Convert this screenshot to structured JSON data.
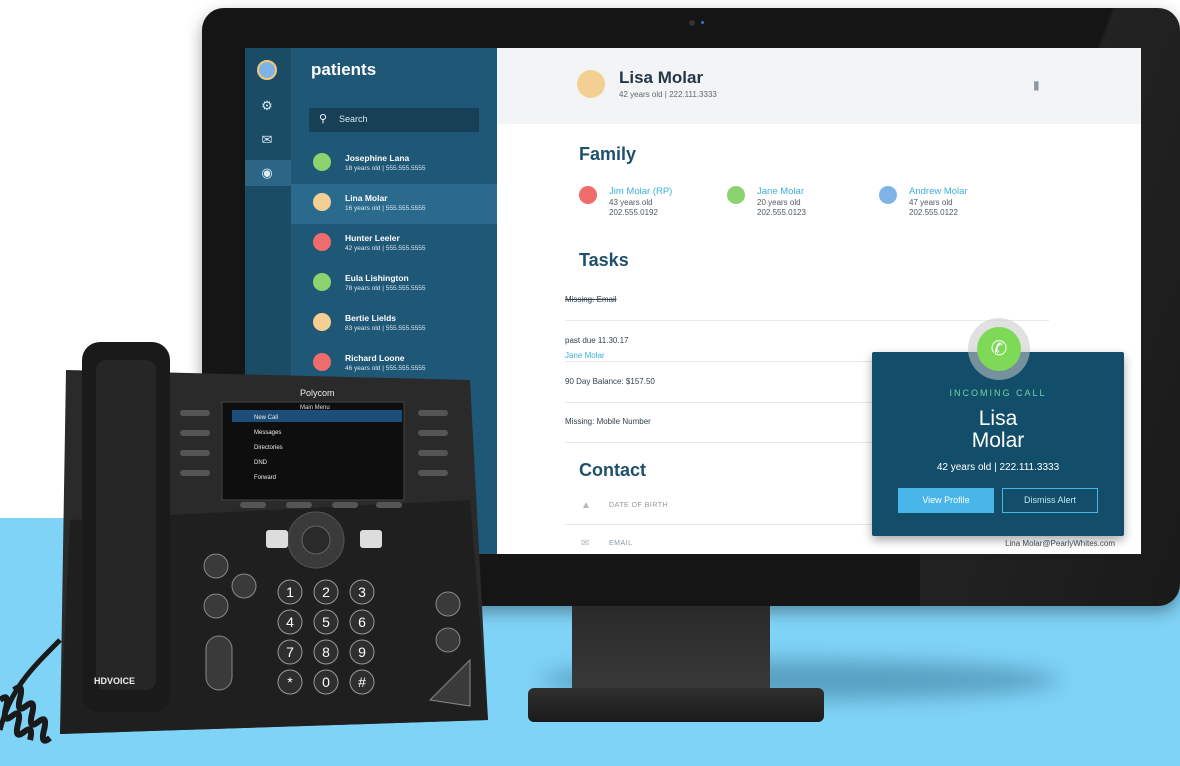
{
  "app": {
    "sidebar_title": "patients",
    "search_placeholder": "Search"
  },
  "patients": [
    {
      "name": "Josephine Lana",
      "meta": "18 years old  |  555.555.5555",
      "color": "#8bd36f"
    },
    {
      "name": "Lina Molar",
      "meta": "16 years old  |  555.555.5555",
      "color": "#f3cf93"
    },
    {
      "name": "Hunter Leeler",
      "meta": "42 years old  |  555.555.5555",
      "color": "#f06b6b"
    },
    {
      "name": "Eula Lishington",
      "meta": "78 years old  |  555.555.5555",
      "color": "#8bd36f"
    },
    {
      "name": "Bertie Lields",
      "meta": "83 years old  |  555.555.5555",
      "color": "#f3cf93"
    },
    {
      "name": "Richard Loone",
      "meta": "46 years old  |  555.555.5555",
      "color": "#f06b6b"
    }
  ],
  "profile": {
    "name": "Lisa Molar",
    "meta": "42 years old  |  222.111.3333"
  },
  "family": {
    "heading": "Family",
    "members": [
      {
        "name": "Jim Molar (RP)",
        "age": "43 years old",
        "phone": "202.555.0192",
        "color": "#f06b6b"
      },
      {
        "name": "Jane Molar",
        "age": "20 years old",
        "phone": "202.555.0123",
        "color": "#8bd36f"
      },
      {
        "name": "Andrew Molar",
        "age": "47 years old",
        "phone": "202.555.0122",
        "color": "#7fb3e6"
      }
    ]
  },
  "tasks": {
    "heading": "Tasks",
    "items": [
      {
        "text": "Missing: Email"
      },
      {
        "link": "Jane Molar",
        "text": " past due 11.30.17"
      },
      {
        "text": "90 Day Balance: $157.50"
      },
      {
        "text": "Missing: Mobile Number"
      }
    ]
  },
  "contact": {
    "heading": "Contact",
    "rows": [
      {
        "label": "DATE OF BIRTH",
        "value": ""
      },
      {
        "label": "EMAIL",
        "value": "Lina Molar@PearlyWhites.com"
      }
    ]
  },
  "incoming_call": {
    "caption": "INCOMING CALL",
    "first_name": "Lisa",
    "last_name": "Molar",
    "meta": "42 years old  |  222.111.3333",
    "view_profile": "View Profile",
    "dismiss": "Dismiss Alert"
  },
  "desk_phone": {
    "brand": "Polycom",
    "menu_title": "Main Menu",
    "menu_items": [
      "New Call",
      "Messages",
      "Directories",
      "DND",
      "Forward"
    ],
    "badge": "HDVOICE",
    "keys": [
      "1",
      "2",
      "3",
      "4",
      "5",
      "6",
      "7",
      "8",
      "9",
      "*",
      "0",
      "#"
    ]
  },
  "colors": {
    "rail": "#1a4c66",
    "sidebar": "#1f5777",
    "accent": "#3cb0de",
    "heading": "#20516a",
    "call_green": "#7ed957",
    "backdrop": "#7fd3f7"
  }
}
